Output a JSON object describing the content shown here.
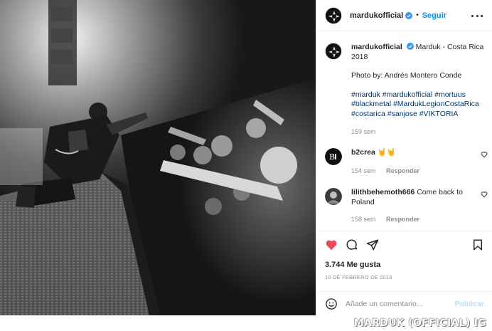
{
  "post": {
    "username": "mardukofficial",
    "follow_label": "Seguir",
    "separator": "•"
  },
  "caption": {
    "username": "mardukofficial",
    "title_line": "Marduk - Costa Rica 2018",
    "credit": "Photo by: Andrés Montero Conde",
    "hashtags": "#marduk #mardukofficial #mortuus #blackmetal #MardukLegionCostaRica #costarica #sanjose #VIKTORIA",
    "age": "159 sem"
  },
  "comments": [
    {
      "username": "b2crea",
      "text": "🤘🤘",
      "age": "154 sem",
      "reply_label": "Responder"
    },
    {
      "username": "lilithbehemoth666",
      "text": "Come back to Poland",
      "age": "158 sem",
      "reply_label": "Responder"
    }
  ],
  "stats": {
    "likes": "3.744 Me gusta",
    "date": "10 DE FEBRERO DE 2019"
  },
  "compose": {
    "placeholder": "Añade un comentario...",
    "publish_label": "Publicar"
  },
  "watermark": "MARDUK (OFFICIAL) IG",
  "colors": {
    "accent": "#0095f6",
    "hashtag": "#00376b",
    "like_active": "#ed4956",
    "muted": "#8e8e8e"
  },
  "icons": [
    "verified-badge-icon",
    "more-options-icon",
    "heart-icon",
    "comment-icon",
    "share-icon",
    "bookmark-icon",
    "emoji-icon"
  ]
}
